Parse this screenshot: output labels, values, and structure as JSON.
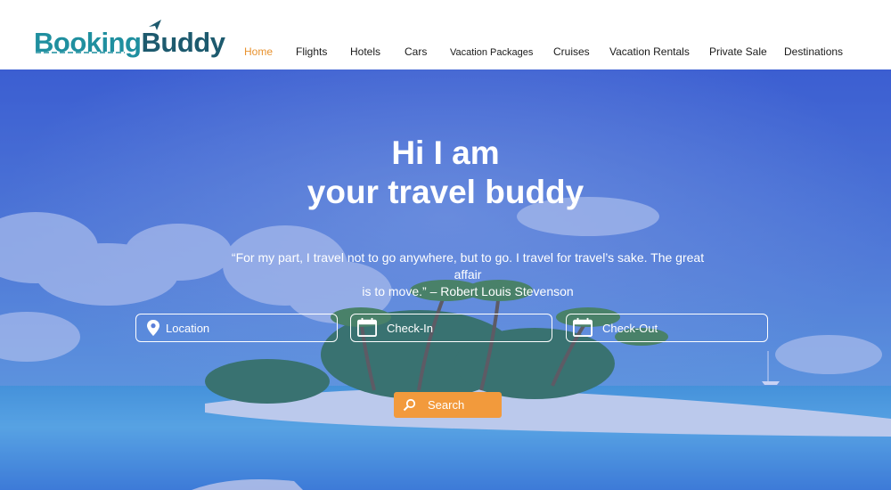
{
  "brand": {
    "part1": "Booking",
    "part2": "Buddy"
  },
  "nav": {
    "items": [
      {
        "label": "Home",
        "active": true
      },
      {
        "label": "Flights",
        "active": false
      },
      {
        "label": "Hotels",
        "active": false
      },
      {
        "label": "Cars",
        "active": false
      },
      {
        "label": "Vacation Packages",
        "active": false
      },
      {
        "label": "Cruises",
        "active": false
      },
      {
        "label": "Vacation Rentals",
        "active": false
      },
      {
        "label": "Private Sale",
        "active": false
      },
      {
        "label": "Destinations",
        "active": false
      }
    ]
  },
  "hero": {
    "headline_line1": "Hi I am",
    "headline_line2": "your travel buddy",
    "quote_line1": "“For my part, I travel not to go anywhere, but to go. I travel for travel’s sake. The great affair",
    "quote_line2": "is to move.” – Robert Louis Stevenson"
  },
  "search": {
    "location_placeholder": "Location",
    "checkin_placeholder": "Check-In",
    "checkout_placeholder": "Check-Out",
    "button_label": "Search"
  },
  "icons": {
    "logo": "plane-icon",
    "location": "map-pin-icon",
    "checkin": "calendar-icon",
    "checkout": "calendar-icon",
    "search": "magnifier-icon"
  },
  "colors": {
    "accent": "#e8922e",
    "button": "#f29a3c",
    "brand_teal": "#1f8f9f",
    "brand_dark": "#1d5a6e",
    "hero_overlay": "#3a5fd6"
  }
}
